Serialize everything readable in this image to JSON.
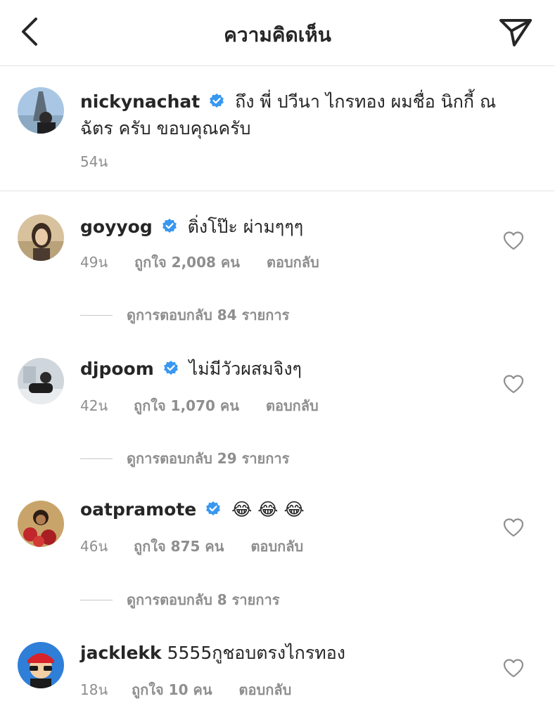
{
  "header": {
    "title": "ความคิดเห็น",
    "back_icon": "chevron-left-icon",
    "send_icon": "paper-plane-icon"
  },
  "caption": {
    "username": "nickynachat",
    "text": "ถึง พี่ ปวีนา ไกรทอง ผมชื่อ นิกกี้ ณฉัตร ครับ ขอบคุณครับ",
    "time": "54น"
  },
  "comments": [
    {
      "username": "goyyog",
      "text": "ติ่งโป๊ะ ผ่ามๆๆๆ",
      "time": "49น",
      "likes": "ถูกใจ 2,008 คน",
      "reply_label": "ตอบกลับ",
      "view_replies": "ดูการตอบกลับ 84 รายการ",
      "verified": true
    },
    {
      "username": "djpoom",
      "text": "ไม่มีวัวผสมจิงๆ",
      "time": "42น",
      "likes": "ถูกใจ 1,070 คน",
      "reply_label": "ตอบกลับ",
      "view_replies": "ดูการตอบกลับ 29 รายการ",
      "verified": true
    },
    {
      "username": "oatpramote",
      "text": "😂 😂 😂",
      "time": "46น",
      "likes": "ถูกใจ 875 คน",
      "reply_label": "ตอบกลับ",
      "view_replies": "ดูการตอบกลับ 8 รายการ",
      "verified": true
    },
    {
      "username": "jacklekk",
      "text": "5555กูชอบตรงไกรทอง",
      "time": "18น",
      "likes": "ถูกใจ 10 คน",
      "reply_label": "ตอบกลับ",
      "verified": false
    }
  ],
  "colors": {
    "text": "#262626",
    "muted": "#8e8e8e",
    "verified": "#3897f0",
    "divider": "#e4e4e4"
  }
}
